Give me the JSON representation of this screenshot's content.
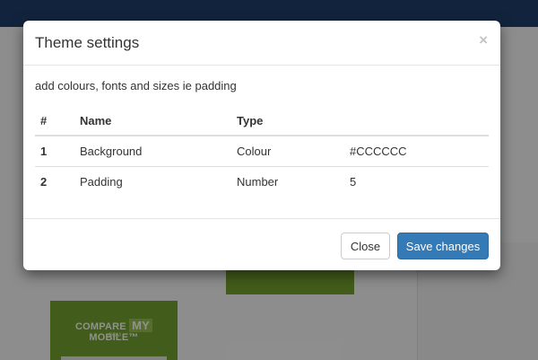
{
  "modal": {
    "title": "Theme settings",
    "close_glyph": "×",
    "intro": "add colours, fonts and sizes ie padding",
    "columns": [
      "#",
      "Name",
      "Type",
      ""
    ],
    "rows": [
      {
        "num": "1",
        "name": "Background",
        "type": "Colour",
        "value": "#CCCCCC"
      },
      {
        "num": "2",
        "name": "Padding",
        "type": "Number",
        "value": "5"
      }
    ],
    "buttons": {
      "close": "Close",
      "save": "Save changes"
    }
  },
  "background": {
    "logo": {
      "pre": "COMPARE",
      "my": "MY",
      "post": "MOBILE™",
      "sub": ".COM"
    }
  },
  "colors": {
    "navbar": "#1f3c66",
    "primary_button": "#337ab7",
    "background_green": "#6f9a2d"
  }
}
